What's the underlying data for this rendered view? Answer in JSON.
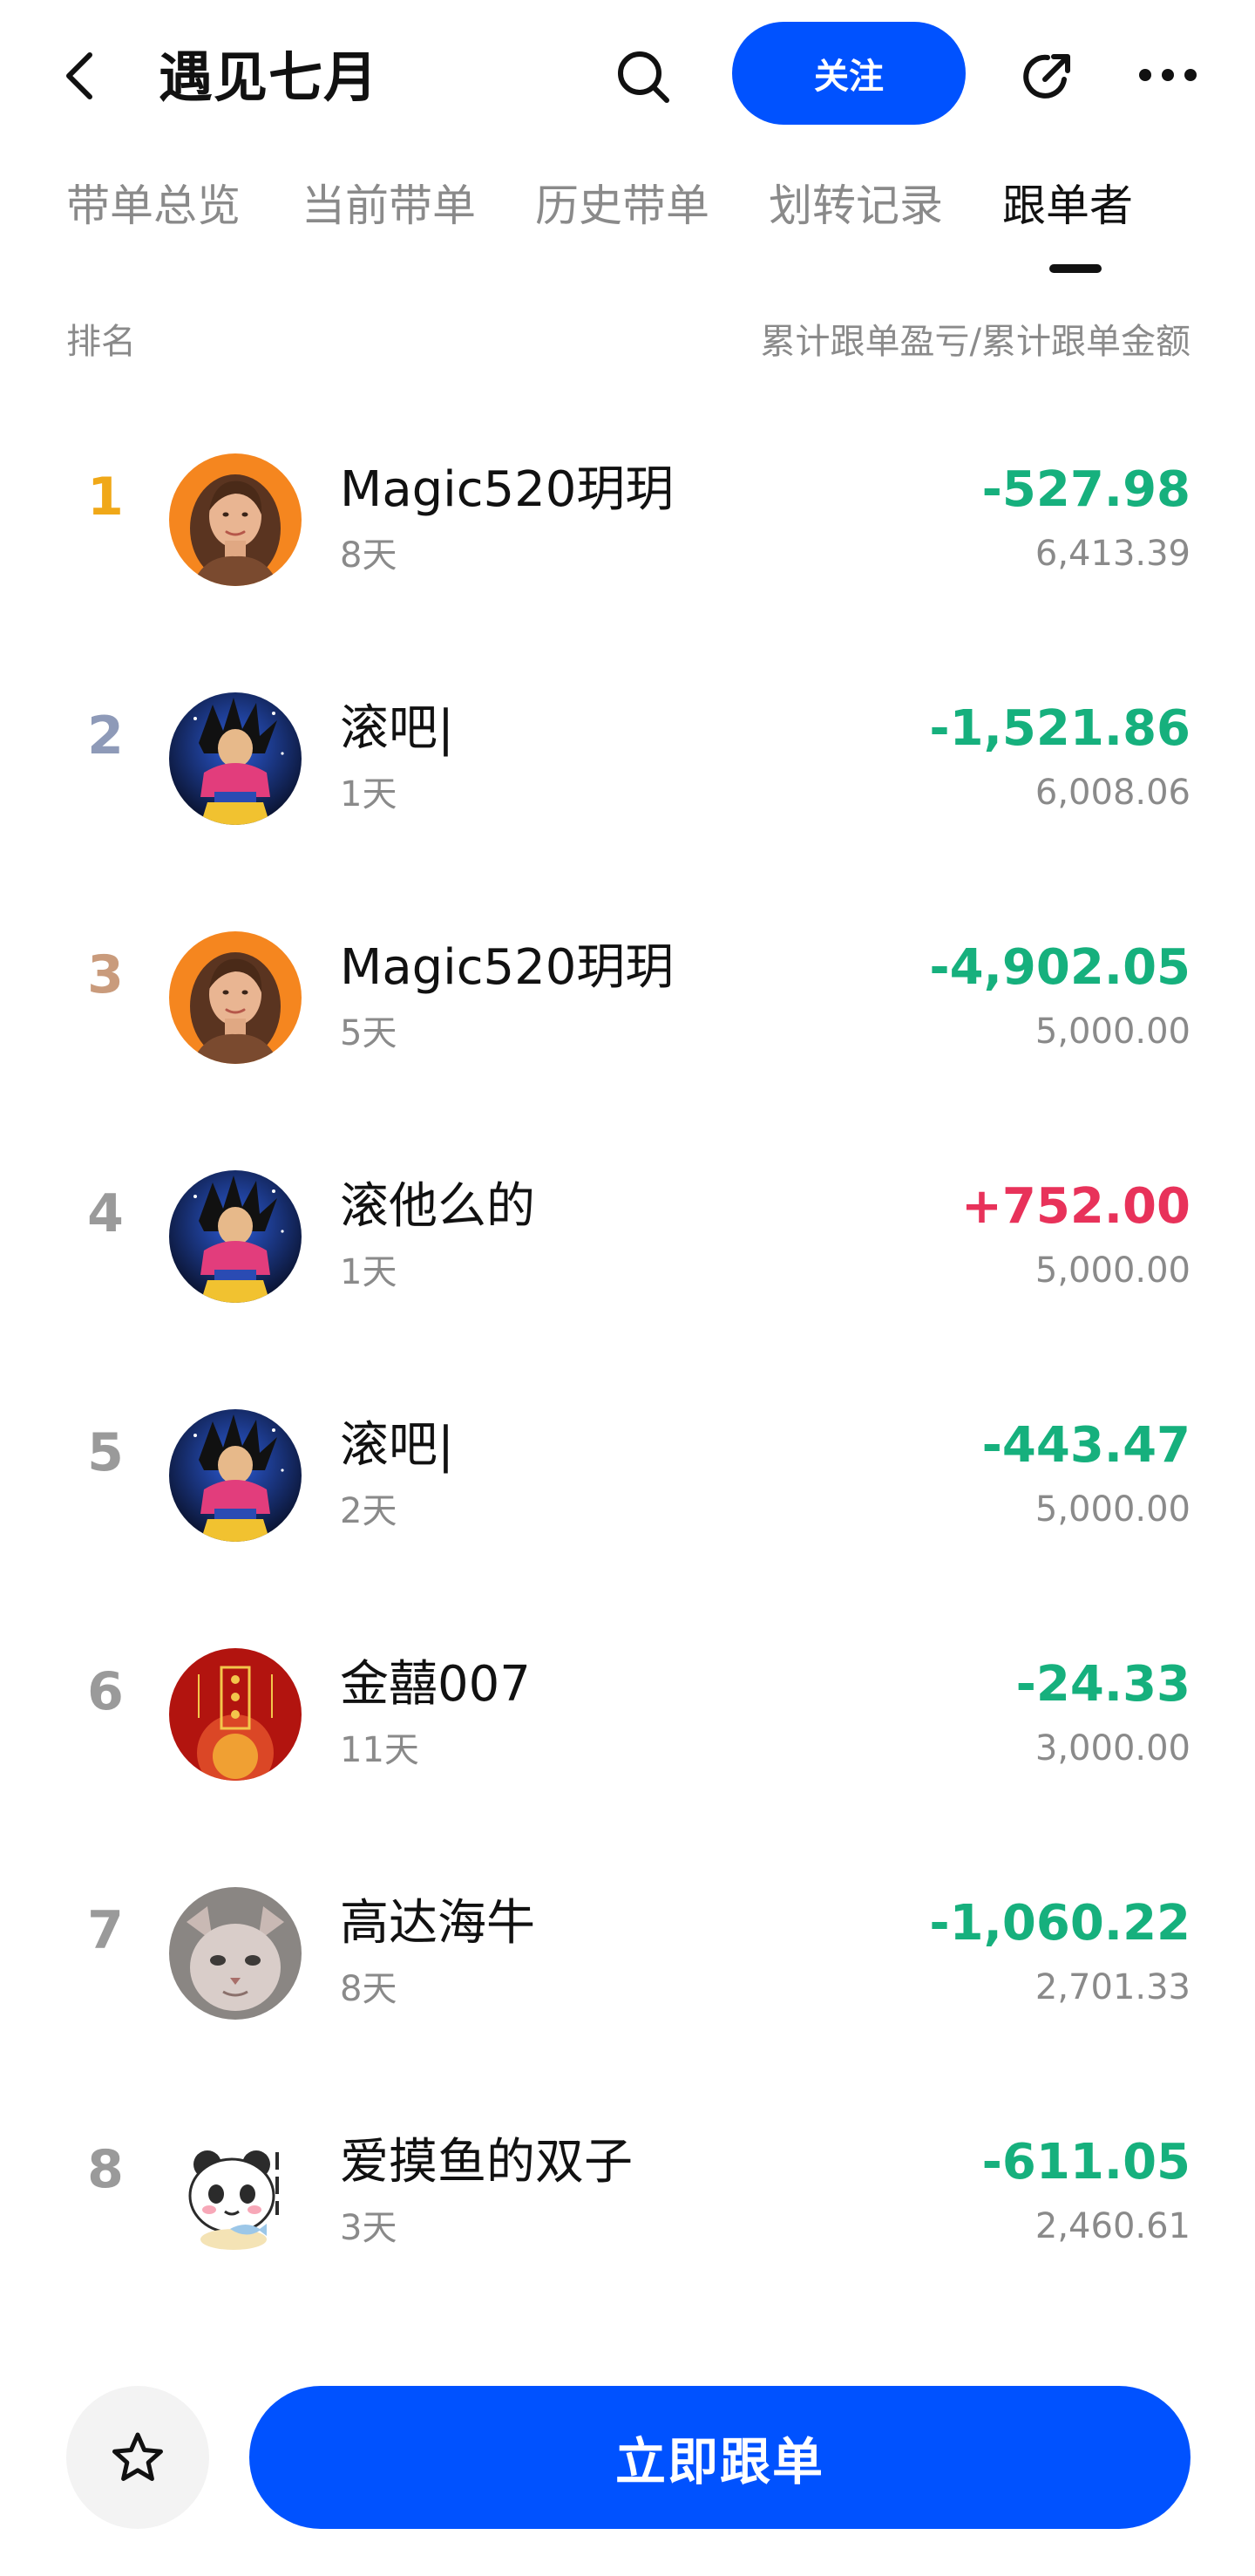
{
  "header": {
    "title": "遇见七月",
    "follow_label": "关注",
    "icons": {
      "back": "chevron-left-icon",
      "search": "search-icon",
      "share": "share-icon",
      "more": "more-icon"
    }
  },
  "tabs": [
    {
      "label": "带单总览",
      "active": false
    },
    {
      "label": "当前带单",
      "active": false
    },
    {
      "label": "历史带单",
      "active": false
    },
    {
      "label": "划转记录",
      "active": false
    },
    {
      "label": "跟单者",
      "active": true
    }
  ],
  "columns": {
    "rank": "排名",
    "metric": "累计跟单盈亏/累计跟单金额"
  },
  "colors": {
    "accent": "#0052ff",
    "loss": "#16b07d",
    "profit": "#e8325a",
    "rank1": "#f0a818",
    "rank2": "#8e9ab8",
    "rank3": "#c99b7c",
    "rank_other": "#9a9a9a"
  },
  "followers": [
    {
      "rank": "1",
      "name": "Magic520玥玥",
      "days": "8天",
      "pnl": "-527.98",
      "amount": "6,413.39",
      "avatar": "woman-portrait"
    },
    {
      "rank": "2",
      "name": "滚吧|",
      "days": "1天",
      "pnl": "-1,521.86",
      "amount": "6,008.06",
      "avatar": "anime-warrior"
    },
    {
      "rank": "3",
      "name": "Magic520玥玥",
      "days": "5天",
      "pnl": "-4,902.05",
      "amount": "5,000.00",
      "avatar": "woman-portrait"
    },
    {
      "rank": "4",
      "name": "滚他么的",
      "days": "1天",
      "pnl": "+752.00",
      "amount": "5,000.00",
      "avatar": "anime-warrior"
    },
    {
      "rank": "5",
      "name": "滚吧|",
      "days": "2天",
      "pnl": "-443.47",
      "amount": "5,000.00",
      "avatar": "anime-warrior"
    },
    {
      "rank": "6",
      "name": "金囍007",
      "days": "11天",
      "pnl": "-24.33",
      "amount": "3,000.00",
      "avatar": "red-fortune"
    },
    {
      "rank": "7",
      "name": "高达海牛",
      "days": "8天",
      "pnl": "-1,060.22",
      "amount": "2,701.33",
      "avatar": "sphynx-cat"
    },
    {
      "rank": "8",
      "name": "爱摸鱼的双子",
      "days": "3天",
      "pnl": "-611.05",
      "amount": "2,460.61",
      "avatar": "panda-cartoon"
    }
  ],
  "bottom": {
    "fav_icon": "star-icon",
    "cta_label": "立即跟单"
  }
}
